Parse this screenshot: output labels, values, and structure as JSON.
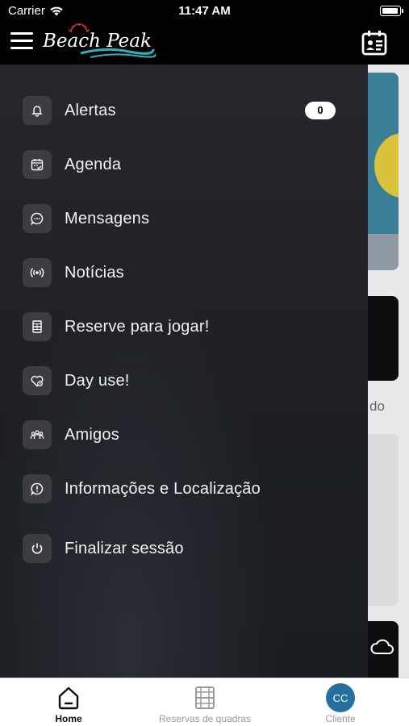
{
  "status_bar": {
    "carrier": "Carrier",
    "time": "11:47 AM"
  },
  "header": {
    "logo_text": "Beach Peak"
  },
  "menu": {
    "items": [
      {
        "label": "Alertas",
        "icon": "bell-icon",
        "badge": "0"
      },
      {
        "label": "Agenda",
        "icon": "calendar-check-icon"
      },
      {
        "label": "Mensagens",
        "icon": "chat-bubble-icon"
      },
      {
        "label": "Notícias",
        "icon": "broadcast-icon"
      },
      {
        "label": "Reserve para jogar!",
        "icon": "court-icon"
      },
      {
        "label": "Day use!",
        "icon": "heart-icon"
      },
      {
        "label": "Amigos",
        "icon": "group-icon"
      },
      {
        "label": "Informações e Localização",
        "icon": "info-icon"
      },
      {
        "label": "Finalizar sessão",
        "icon": "power-icon"
      }
    ]
  },
  "background": {
    "partial_text": "do"
  },
  "tabbar": {
    "home": "Home",
    "reservas": "Reservas de quadras",
    "cliente": "Cliente",
    "avatar_initials": "CC"
  },
  "colors": {
    "drawer_bg": "#1d1f24",
    "icon_bg": "#3b3d43",
    "avatar": "#2470a0",
    "logo_wave": "#2bb3c0",
    "logo_sun": "#e0303a"
  }
}
